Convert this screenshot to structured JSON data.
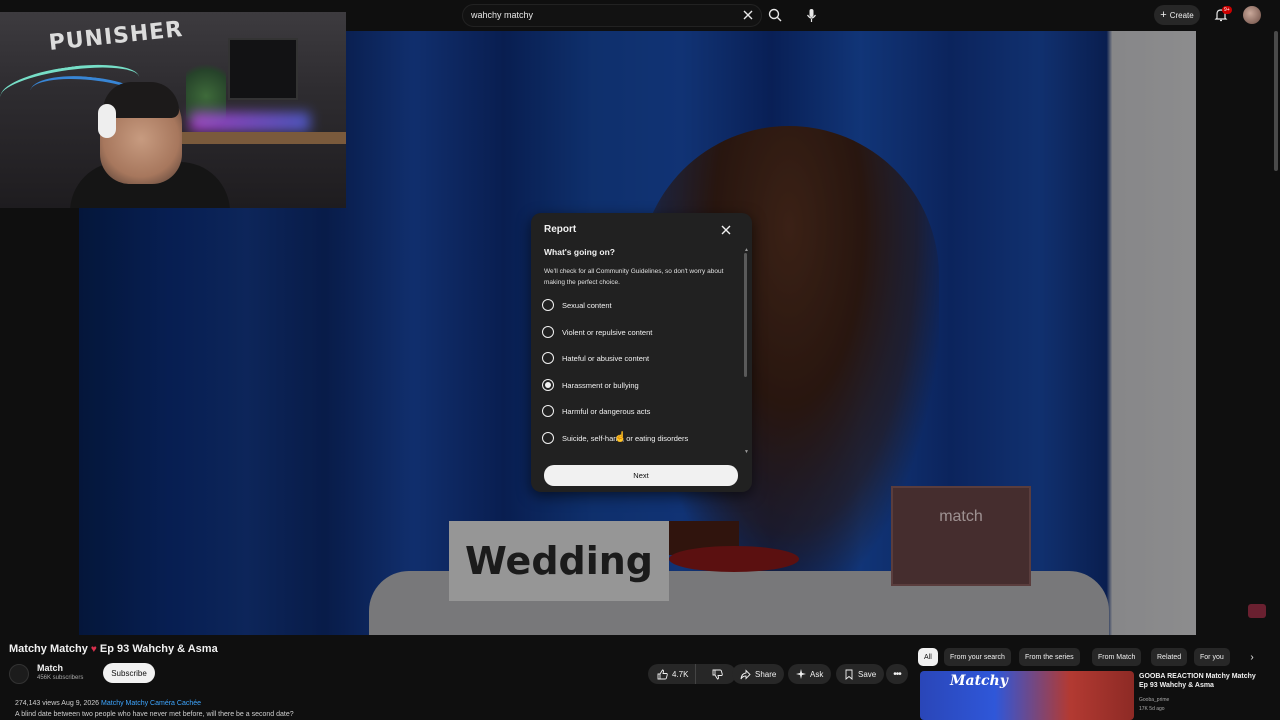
{
  "topbar": {
    "search_value": "wahchy matchy",
    "create_label": "Create",
    "notification_count": "9+"
  },
  "video": {
    "title": "Matchy Matchy",
    "title_suffix": "Ep 93 Wahchy & Asma",
    "placard_text": "Wedding",
    "box_logo": "match"
  },
  "webcam": {
    "logo_text": "PUNISHER"
  },
  "channel": {
    "name": "Match",
    "subscribers": "456K subscribers",
    "subscribe_label": "Subscribe"
  },
  "description": {
    "meta": "274,143 views  Aug 9, 2026",
    "tags": "Matchy Matchy Caméra Cachée",
    "text": "A blind date between two people who have never met before, will there be a second date?"
  },
  "actions": {
    "likes": "4.7K",
    "share": "Share",
    "ask": "Ask",
    "save": "Save"
  },
  "chips": [
    "All",
    "From your search",
    "From the series",
    "From Match",
    "Related",
    "For you"
  ],
  "recommendation": {
    "thumb_text": "Matchy",
    "title": "GOOBA REACTION Matchy Matchy Ep 93 Wahchy & Asma",
    "channel": "Gooba_prime",
    "meta": "17K  5d ago"
  },
  "report_dialog": {
    "title": "Report",
    "heading": "What's going on?",
    "subtext": "We'll check for all Community Guidelines, so don't worry about making the perfect choice.",
    "options": [
      {
        "label": "Sexual content",
        "selected": false
      },
      {
        "label": "Violent or repulsive content",
        "selected": false
      },
      {
        "label": "Hateful or abusive content",
        "selected": false
      },
      {
        "label": "Harassment or bullying",
        "selected": true
      },
      {
        "label": "Harmful or dangerous acts",
        "selected": false
      },
      {
        "label": "Suicide, self-harm, or eating disorders",
        "selected": false
      }
    ],
    "next_label": "Next"
  },
  "colors": {
    "background": "#0f0f0f",
    "dialog": "#212121",
    "accent_link": "#3ea6ff",
    "notification_badge": "#cc0000",
    "heart": "#d9304d"
  },
  "icons": [
    "search-icon",
    "clear-icon",
    "mic-icon",
    "plus-icon",
    "bell-icon",
    "close-icon",
    "like-icon",
    "dislike-icon",
    "share-icon",
    "sparkle-icon",
    "save-icon",
    "more-icon",
    "chevron-right-icon",
    "heart-icon"
  ]
}
